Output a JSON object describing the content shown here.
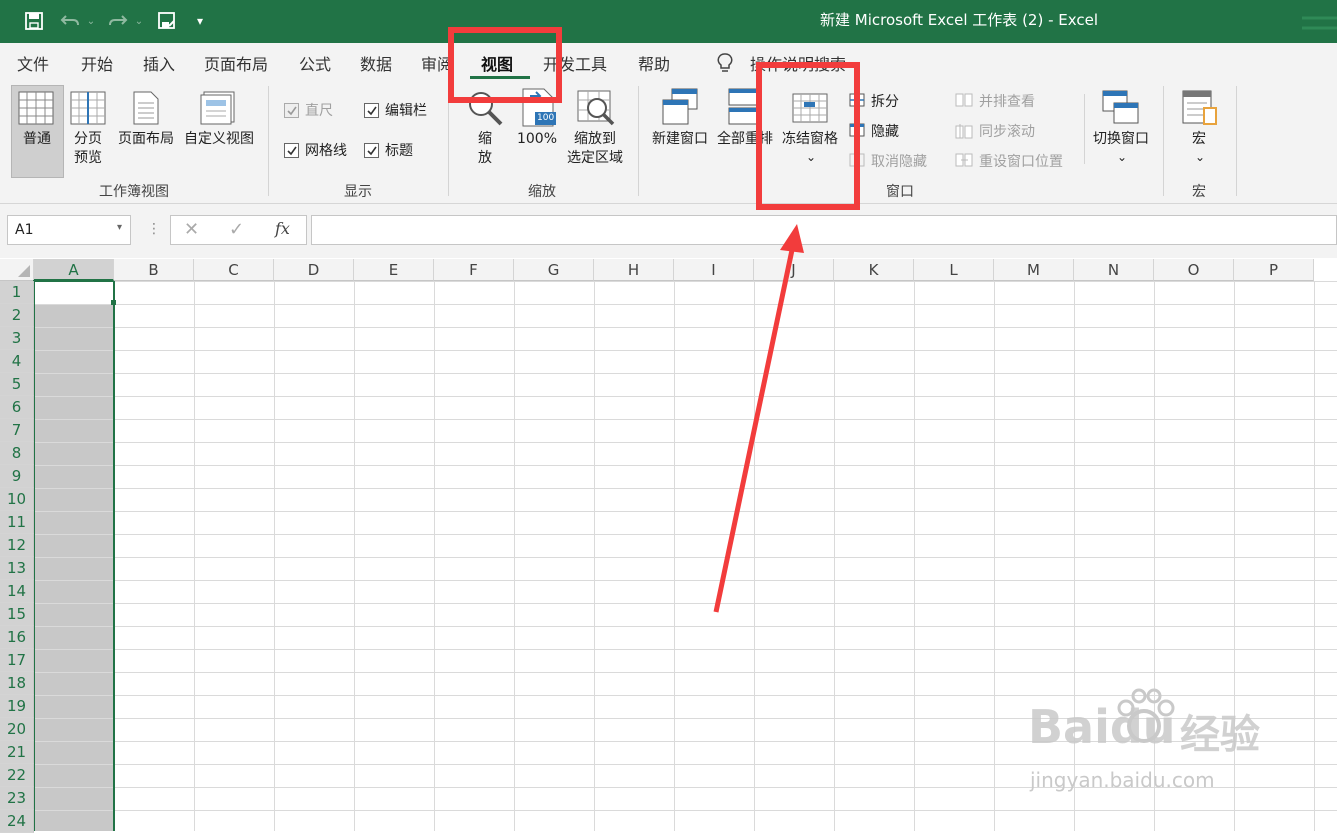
{
  "title_bar": {
    "title": "新建 Microsoft Excel 工作表 (2)  -  Excel",
    "quick_access_more": "▾"
  },
  "ribbon_tabs": [
    {
      "label": "文件"
    },
    {
      "label": "开始"
    },
    {
      "label": "插入"
    },
    {
      "label": "页面布局"
    },
    {
      "label": "公式"
    },
    {
      "label": "数据"
    },
    {
      "label": "审阅"
    },
    {
      "label": "视图",
      "active": true
    },
    {
      "label": "开发工具"
    },
    {
      "label": "帮助"
    }
  ],
  "tell_me": {
    "label": "操作说明搜索",
    "icon": "lightbulb-icon"
  },
  "groups": {
    "workbook_views": {
      "label": "工作簿视图",
      "normal": "普通",
      "page_break_preview": "分页\n预览",
      "page_layout": "页面布局",
      "custom_views": "自定义视图"
    },
    "show": {
      "label": "显示",
      "ruler": "直尺",
      "formula_bar": "编辑栏",
      "gridlines": "网格线",
      "headings": "标题",
      "ruler_checked": true,
      "formula_bar_checked": true,
      "gridlines_checked": true,
      "headings_checked": true
    },
    "zoom": {
      "label": "缩放",
      "zoom": "缩\n放",
      "zoom_100": "100%",
      "zoom_100_badge": "100",
      "zoom_to_selection": "缩放到\n选定区域"
    },
    "window": {
      "label": "窗口",
      "new_window": "新建窗口",
      "arrange_all": "全部重排",
      "freeze_panes": "冻结窗格",
      "freeze_chevron": "⌄",
      "split": "拆分",
      "hide": "隐藏",
      "unhide": "取消隐藏",
      "view_side_by_side": "并排查看",
      "sync_scrolling": "同步滚动",
      "reset_window_position": "重设窗口位置",
      "switch_windows": "切换窗口",
      "switch_chevron": "⌄"
    },
    "macros": {
      "label": "宏",
      "macros": "宏",
      "chevron": "⌄"
    }
  },
  "formula_bar": {
    "name_box": "A1",
    "name_box_arrow": "▾",
    "more": "⋮",
    "cancel": "✕",
    "enter": "✓",
    "fx": "fx",
    "formula_value": ""
  },
  "sheet": {
    "columns": [
      "A",
      "B",
      "C",
      "D",
      "E",
      "F",
      "G",
      "H",
      "I",
      "J",
      "K",
      "L",
      "M",
      "N",
      "O",
      "P"
    ],
    "rows": [
      "1",
      "2",
      "3",
      "4",
      "5",
      "6",
      "7",
      "8",
      "9",
      "10",
      "11",
      "12",
      "13",
      "14",
      "15",
      "16",
      "17",
      "18",
      "19",
      "20",
      "21",
      "22",
      "23",
      "24"
    ],
    "selected_column": "A",
    "active_cell": "A1"
  },
  "watermark": {
    "brand": "Baidu",
    "product": "经验",
    "url": "jingyan.baidu.com"
  },
  "colors": {
    "excel_green": "#217346",
    "annotation_red": "#f23c3c"
  }
}
